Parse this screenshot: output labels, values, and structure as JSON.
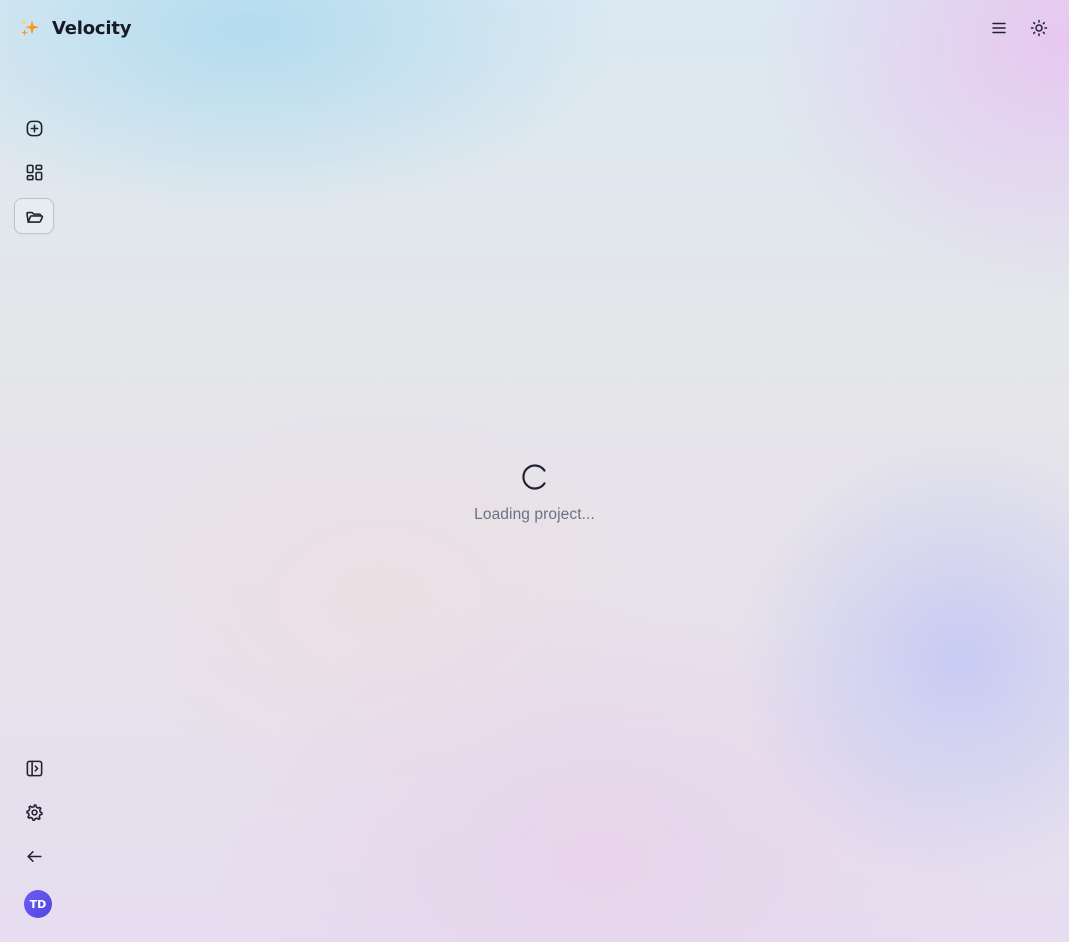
{
  "app": {
    "name": "Velocity",
    "logo_icon": "sparkles-icon",
    "accent_color": "#f59e0b"
  },
  "topbar": {
    "actions": [
      {
        "icon": "menu-icon",
        "label": "Menu"
      },
      {
        "icon": "sun-icon",
        "label": "Toggle theme"
      }
    ]
  },
  "sidebar": {
    "top_items": [
      {
        "icon": "plus-circle-icon",
        "label": "New project",
        "active": false
      },
      {
        "icon": "layout-grid-icon",
        "label": "Dashboard",
        "active": false
      },
      {
        "icon": "folder-open-icon",
        "label": "Projects",
        "active": true
      }
    ],
    "bottom_items": [
      {
        "icon": "panel-left-icon",
        "label": "Toggle sidebar"
      },
      {
        "icon": "gear-icon",
        "label": "Settings"
      },
      {
        "icon": "arrow-left-icon",
        "label": "Back"
      }
    ],
    "user": {
      "initials": "TD",
      "avatar_color": "#5b4ff0"
    }
  },
  "main": {
    "loading_text": "Loading project..."
  }
}
